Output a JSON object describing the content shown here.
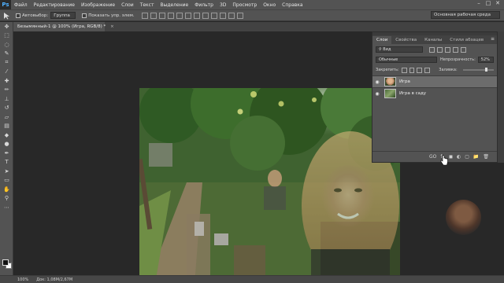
{
  "app": {
    "logo": "Ps"
  },
  "menu": [
    "Файл",
    "Редактирование",
    "Изображение",
    "Слои",
    "Текст",
    "Выделение",
    "Фильтр",
    "3D",
    "Просмотр",
    "Окно",
    "Справка"
  ],
  "window_controls": [
    "–",
    "□",
    "✕"
  ],
  "options": {
    "autoselect_label": "Автовыбор:",
    "autoselect_value": "Группа",
    "show_controls_label": "Показать упр. элем.",
    "workspace": "Основная рабочая среда"
  },
  "document_tab": {
    "title": "Безымянный-1 @ 100% (Игра, RGB/8) *",
    "close": "×"
  },
  "status": {
    "zoom": "100%",
    "doc": "Док: 1,08М/2,67М"
  },
  "layers_panel": {
    "tabs": [
      "Слои",
      "Свойства",
      "Каналы",
      "Стили абзацев"
    ],
    "filter_select": "Вид",
    "blend_mode": "Обычные",
    "opacity_label": "Непрозрачность:",
    "opacity_value": "52%",
    "lock_label": "Закрепить:",
    "fill_label": "Заливка:",
    "fill_value": "100%",
    "layers": [
      {
        "name": "Игра",
        "selected": true,
        "thumb": "face"
      },
      {
        "name": "Игра в саду",
        "selected": false,
        "thumb": "garden"
      }
    ],
    "footer_icons": [
      "GO",
      "fx",
      "◼",
      "◐",
      "▢",
      "📁",
      "🗑"
    ]
  },
  "toolbar_tools": [
    "move-tool",
    "marquee-tool",
    "lasso-tool",
    "quick-select-tool",
    "crop-tool",
    "eyedropper-tool",
    "healing-tool",
    "brush-tool",
    "clone-stamp-tool",
    "history-brush-tool",
    "eraser-tool",
    "gradient-tool",
    "blur-tool",
    "dodge-tool",
    "pen-tool",
    "type-tool",
    "path-select-tool",
    "rectangle-tool",
    "hand-tool",
    "zoom-tool",
    "more-tools"
  ]
}
